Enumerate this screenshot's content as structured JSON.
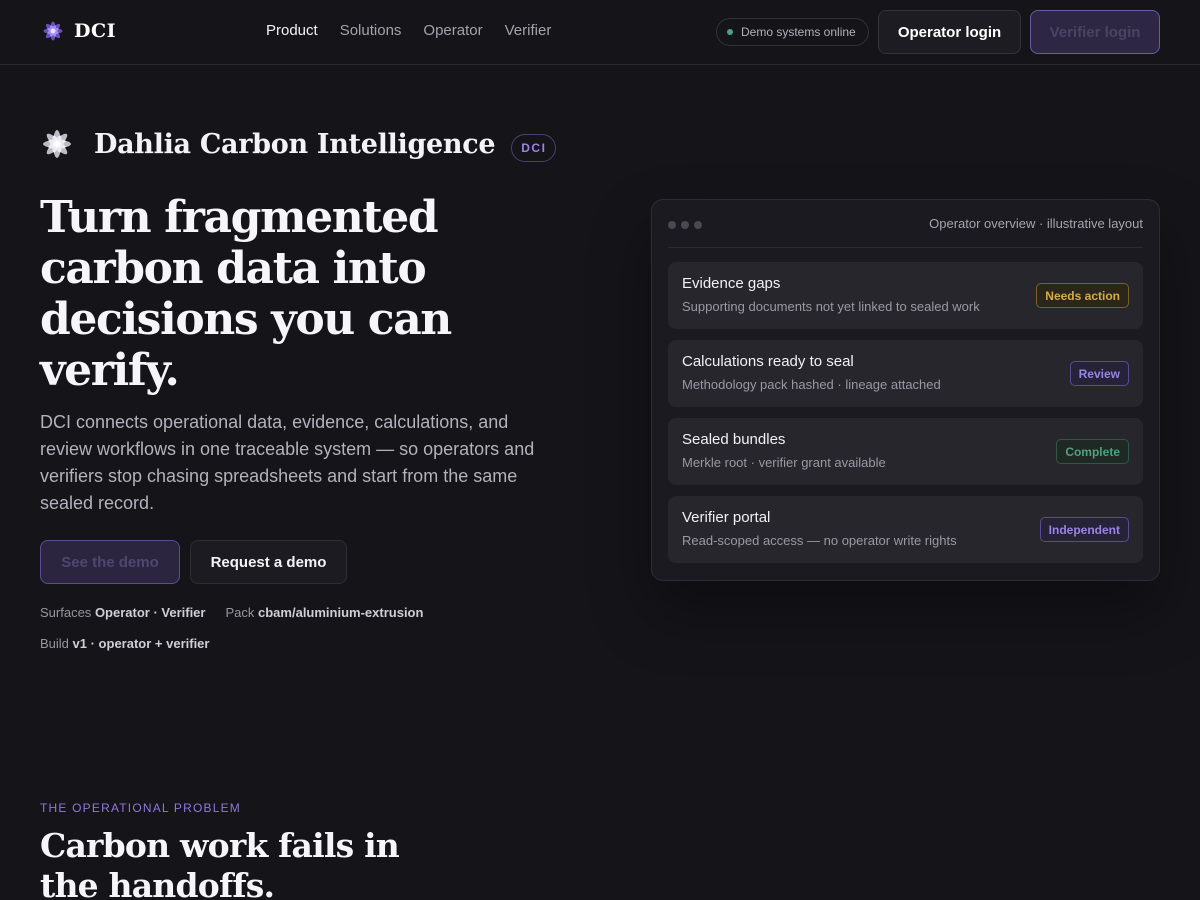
{
  "nav": {
    "brand": "DCI",
    "links": [
      {
        "label": "Product",
        "active": true
      },
      {
        "label": "Solutions",
        "active": false
      },
      {
        "label": "Operator",
        "active": false
      },
      {
        "label": "Verifier",
        "active": false
      }
    ],
    "status": "Demo systems online",
    "operator_login": "Operator login",
    "verifier_login": "Verifier login"
  },
  "hero": {
    "brand_name": "Dahlia Carbon Intelligence",
    "brand_badge": "DCI",
    "headline": "Turn fragmented carbon data into decisions you can verify.",
    "lede": "DCI connects operational data, evidence, calculations, and review workflows in one traceable system — so operators and verifiers stop chasing spreadsheets and start from the same sealed record.",
    "cta_primary": "See the demo",
    "cta_secondary": "Request a demo",
    "meta": {
      "surfaces_label": "Surfaces",
      "surfaces_value": "Operator · Verifier",
      "pack_label": "Pack",
      "pack_value": "cbam/aluminium-extrusion",
      "build_label": "Build",
      "build_value": "v1 · operator + verifier"
    }
  },
  "panel": {
    "caption": "Operator overview · illustrative layout",
    "rows": [
      {
        "title": "Evidence gaps",
        "subtitle": "Supporting documents not yet linked to sealed work",
        "tag": "Needs action"
      },
      {
        "title": "Calculations ready to seal",
        "subtitle": "Methodology pack hashed · lineage attached",
        "tag": "Review"
      },
      {
        "title": "Sealed bundles",
        "subtitle": "Merkle root · verifier grant available",
        "tag": "Complete"
      },
      {
        "title": "Verifier portal",
        "subtitle": "Read-scoped access — no operator write rights",
        "tag": "Independent"
      }
    ]
  },
  "problem": {
    "eyebrow": "THE OPERATIONAL PROBLEM",
    "title": "Carbon work fails in the handoffs."
  },
  "colors": {
    "background": "#151419",
    "accent": "#9b84e6",
    "status_online": "#4fa37c",
    "tag_amber": "#d6ab4a",
    "tag_green": "#4fa37c"
  },
  "icons": {
    "logo": "dahlia-flower-icon",
    "status": "status-dot-icon"
  }
}
